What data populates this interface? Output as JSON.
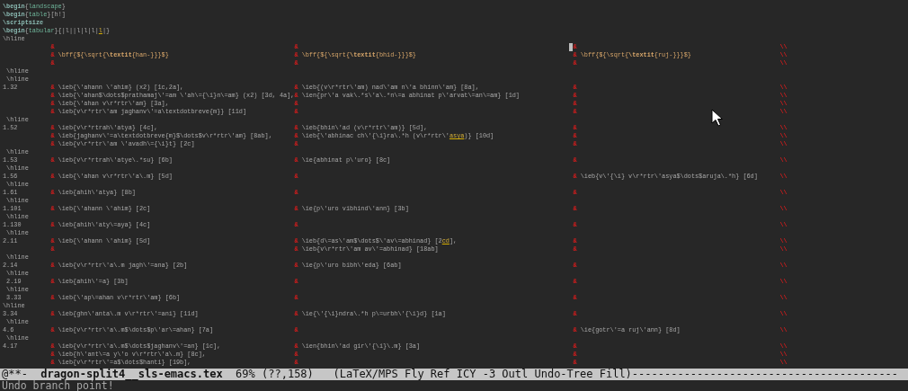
{
  "lines": [
    {
      "kind": "code",
      "segs": [
        {
          "t": "\\begin",
          "kind": "keyword"
        },
        {
          "t": "{",
          "kind": "plain"
        },
        {
          "t": "landscape",
          "kind": "arg"
        },
        {
          "t": "}",
          "kind": "plain"
        }
      ]
    },
    {
      "kind": "code",
      "segs": [
        {
          "t": "\\begin",
          "kind": "keyword"
        },
        {
          "t": "{",
          "kind": "plain"
        },
        {
          "t": "table",
          "kind": "arg"
        },
        {
          "t": "}[h!]",
          "kind": "plain"
        }
      ]
    },
    {
      "kind": "code",
      "segs": [
        {
          "t": "\\scriptsize",
          "kind": "keyword"
        }
      ]
    },
    {
      "kind": "code",
      "segs": [
        {
          "t": "\\begin",
          "kind": "keyword"
        },
        {
          "t": "{",
          "kind": "plain"
        },
        {
          "t": "tabular",
          "kind": "arg"
        },
        {
          "t": "}{|l||l|l|l|",
          "kind": "plain"
        },
        {
          "t": "l",
          "kind": "flagged"
        },
        {
          "t": "|}",
          "kind": "plain"
        }
      ]
    },
    {
      "kind": "code",
      "segs": [
        {
          "t": "\\hline",
          "kind": "plain"
        }
      ]
    },
    {
      "kind": "row",
      "cells": [
        {
          "sep": "&"
        },
        {
          "sep": "&"
        },
        {
          "sep": "&",
          "cursor": true
        }
      ],
      "end": "\\\\"
    },
    {
      "kind": "row",
      "cells": [
        {
          "sep": "&",
          "segs": [
            {
              "t": "\\bff{${\\sqrt{",
              "kind": "accent"
            },
            {
              "t": "\\textit",
              "kind": "strong"
            },
            {
              "t": "{han-}}}$}",
              "kind": "accent"
            }
          ]
        },
        {
          "sep": "&",
          "segs": [
            {
              "t": "\\bff{${\\sqrt{",
              "kind": "accent"
            },
            {
              "t": "\\textit",
              "kind": "strong"
            },
            {
              "t": "{bhid-}}}$}",
              "kind": "accent"
            }
          ]
        },
        {
          "sep": "&",
          "segs": [
            {
              "t": "\\bff{${\\sqrt{",
              "kind": "accent"
            },
            {
              "t": "\\textit",
              "kind": "strong"
            },
            {
              "t": "{ruj-}}}$}",
              "kind": "accent"
            }
          ]
        }
      ],
      "end": "\\\\"
    },
    {
      "kind": "row",
      "cells": [
        {
          "sep": "&"
        },
        {
          "sep": "&"
        },
        {
          "sep": "&"
        }
      ],
      "end": "\\\\"
    },
    {
      "kind": "code",
      "segs": [
        {
          "t": " \\hline",
          "kind": "plain"
        }
      ]
    },
    {
      "kind": "code",
      "segs": [
        {
          "t": " \\hline",
          "kind": "plain"
        }
      ]
    },
    {
      "kind": "row",
      "lead": "1.32",
      "cells": [
        {
          "sep": "&",
          "text": "\\ieb{\\'ahann \\'ahim} (x2) [1c,2a],"
        },
        {
          "sep": "&",
          "text": "\\ieb{(v\\r*rtr\\'am) nad\\'am n\\'a bhinn\\'am} [8a],"
        },
        {
          "sep": "&"
        }
      ],
      "end": "\\\\"
    },
    {
      "kind": "row",
      "cells": [
        {
          "sep": "&",
          "text": "\\ieb{\\'ahan$\\dots$prathamaj\\'=am \\'ah\\={\\i}n\\=am} (x2) [3d, 4a],"
        },
        {
          "sep": "&",
          "text": "\\ien{pr\\'a vak\\.*s\\'a\\.*n\\=a abhinat p\\'arvat\\=an\\=am} [1d]"
        },
        {
          "sep": "&"
        }
      ],
      "end": "\\\\"
    },
    {
      "kind": "row",
      "cells": [
        {
          "sep": "&",
          "text": "\\ieb{\\'ahan v\\r*rtr\\'am} [3a],"
        },
        {
          "sep": "&"
        },
        {
          "sep": "&"
        }
      ],
      "end": "\\\\"
    },
    {
      "kind": "row",
      "cells": [
        {
          "sep": "&",
          "text": "\\ieb{v\\r*rtr\\'am jaghanv\\'=a\\textdotbreve{m}} [11d]"
        },
        {
          "sep": "&"
        },
        {
          "sep": "&"
        }
      ],
      "end": "\\\\"
    },
    {
      "kind": "code",
      "segs": [
        {
          "t": " \\hline",
          "kind": "plain"
        }
      ]
    },
    {
      "kind": "row",
      "lead": "1.52",
      "cells": [
        {
          "sep": "&",
          "text": "\\ieb{v\\r*rtrah\\'atya} [4c],"
        },
        {
          "sep": "&",
          "text": "\\ieb{bhin\\'ad (v\\r*rtr\\'am)} [5d],"
        },
        {
          "sep": "&"
        }
      ],
      "end": "\\\\"
    },
    {
      "kind": "row",
      "cells": [
        {
          "sep": "&",
          "text": "\\ieb{jaghanv\\'=a\\textdotbreve{m}$\\dots$v\\r*rtr\\'am} [8ab],"
        },
        {
          "sep": "&",
          "segs": [
            {
              "t": "\\ieb{\\'abhinac ch\\'{\\i}ra\\.*h (v\\r*rtr\\'",
              "kind": "plain"
            },
            {
              "t": "asya",
              "kind": "flagged"
            },
            {
              "t": ")} [10d]",
              "kind": "plain"
            }
          ]
        },
        {
          "sep": "&"
        }
      ],
      "end": "\\\\"
    },
    {
      "kind": "row",
      "cells": [
        {
          "sep": "&",
          "text": "\\ieb{v\\r*rtr\\'am \\'avadh\\={\\i}t} [2c]"
        },
        {
          "sep": "&"
        },
        {
          "sep": "&"
        }
      ],
      "end": "\\\\"
    },
    {
      "kind": "code",
      "segs": [
        {
          "t": " \\hline",
          "kind": "plain"
        }
      ]
    },
    {
      "kind": "row",
      "lead": "1.53",
      "cells": [
        {
          "sep": "&",
          "text": "\\ieb{v\\r*rtrah\\'atye\\.*su} [6b]"
        },
        {
          "sep": "&",
          "text": "\\ie{abhinat p\\'uro} [8c]"
        },
        {
          "sep": "&"
        }
      ],
      "end": "\\\\"
    },
    {
      "kind": "code",
      "segs": [
        {
          "t": " \\hline",
          "kind": "plain"
        }
      ]
    },
    {
      "kind": "row",
      "lead": "1.56",
      "cells": [
        {
          "sep": "&",
          "text": "\\ieb{\\'ahan v\\r*rtr\\'a\\.m} [5d]"
        },
        {
          "sep": "&"
        },
        {
          "sep": "&",
          "text": "\\ieb{v\\'{\\i} v\\r*rtr\\'asya$\\dots$aruja\\.*h} [6d]"
        }
      ],
      "end": "\\\\"
    },
    {
      "kind": "code",
      "segs": [
        {
          "t": " \\hline",
          "kind": "plain"
        }
      ]
    },
    {
      "kind": "row",
      "lead": "1.61",
      "cells": [
        {
          "sep": "&",
          "text": "\\ieb{ahih\\'atya} [8b]"
        },
        {
          "sep": "&"
        },
        {
          "sep": "&"
        }
      ],
      "end": "\\\\"
    },
    {
      "kind": "code",
      "segs": [
        {
          "t": " \\hline",
          "kind": "plain"
        }
      ]
    },
    {
      "kind": "row",
      "lead": "1.101",
      "cells": [
        {
          "sep": "&",
          "text": "\\ieb{\\'ahann \\'ahim} [2c]"
        },
        {
          "sep": "&",
          "text": "\\ie{p\\'uro vibhind\\'ann} [3b]"
        },
        {
          "sep": "&"
        }
      ],
      "end": "\\\\"
    },
    {
      "kind": "code",
      "segs": [
        {
          "t": " \\hline",
          "kind": "plain"
        }
      ]
    },
    {
      "kind": "row",
      "lead": "1.130",
      "cells": [
        {
          "sep": "&",
          "text": "\\ieb{ahih\\'aty\\=aya} [4c]"
        },
        {
          "sep": "&"
        },
        {
          "sep": "&"
        }
      ],
      "end": "\\\\"
    },
    {
      "kind": "code",
      "segs": [
        {
          "t": " \\hline",
          "kind": "plain"
        }
      ]
    },
    {
      "kind": "row",
      "lead": "2.11",
      "cells": [
        {
          "sep": "&",
          "text": "\\ieb{\\'ahann \\'ahim} [5d]"
        },
        {
          "sep": "&",
          "segs": [
            {
              "t": "\\ieb{d\\=as\\'am$\\dots$\\'av\\=abhinad} [2",
              "kind": "plain"
            },
            {
              "t": "cd",
              "kind": "flagged"
            },
            {
              "t": "],",
              "kind": "plain"
            }
          ]
        },
        {
          "sep": "&"
        }
      ],
      "end": "\\\\"
    },
    {
      "kind": "row",
      "cells": [
        {
          "sep": "&"
        },
        {
          "sep": "&",
          "text": "\\ieb{v\\r*rtr\\'am av\\'=abhinad} [18ab]"
        },
        {
          "sep": "&"
        }
      ],
      "end": "\\\\"
    },
    {
      "kind": "code",
      "segs": [
        {
          "t": " \\hline",
          "kind": "plain"
        }
      ]
    },
    {
      "kind": "row",
      "lead": "2.14",
      "cells": [
        {
          "sep": "&",
          "text": "\\ieb{v\\r*rtr\\'a\\.m jagh\\'=ana} [2b]"
        },
        {
          "sep": "&",
          "text": "\\ie{p\\'uro bibh\\'eda} [6ab]"
        },
        {
          "sep": "&"
        }
      ],
      "end": "\\\\"
    },
    {
      "kind": "code",
      "segs": [
        {
          "t": " \\hline",
          "kind": "plain"
        }
      ]
    },
    {
      "kind": "row",
      "lead": " 2.19",
      "cells": [
        {
          "sep": "&",
          "text": "\\ieb{ahih\\'=a} [3b]"
        },
        {
          "sep": "&"
        },
        {
          "sep": "&"
        }
      ],
      "end": "\\\\"
    },
    {
      "kind": "code",
      "segs": [
        {
          "t": " \\hline",
          "kind": "plain"
        }
      ]
    },
    {
      "kind": "row",
      "lead": " 3.33",
      "cells": [
        {
          "sep": "&",
          "text": "\\ieb{\\'ap\\=ahan v\\r*rtr\\'am} [6b]"
        },
        {
          "sep": "&"
        },
        {
          "sep": "&"
        }
      ],
      "end": "\\\\"
    },
    {
      "kind": "code",
      "segs": [
        {
          "t": "\\hline",
          "kind": "plain"
        }
      ]
    },
    {
      "kind": "row",
      "lead": "3.34",
      "cells": [
        {
          "sep": "&",
          "text": "\\ieb{ghn\\'anta\\.m v\\r*rtr\\'=ani} [11d]"
        },
        {
          "sep": "&",
          "text": "\\ie{\\'{\\i}ndra\\.*h p\\=urbh\\'{\\i}d} [1a]"
        },
        {
          "sep": "&"
        }
      ],
      "end": "\\\\"
    },
    {
      "kind": "code",
      "segs": [
        {
          "t": " \\hline",
          "kind": "plain"
        }
      ]
    },
    {
      "kind": "row",
      "lead": "4.6",
      "cells": [
        {
          "sep": "&",
          "text": "\\ieb{v\\r*rtr\\'a\\.m$\\dots$p\\'ar\\=ahan} [7a]"
        },
        {
          "sep": "&"
        },
        {
          "sep": "&",
          "text": "\\ie{gotr\\'=a ruj\\'ann} [8d]"
        }
      ],
      "end": "\\\\"
    },
    {
      "kind": "code",
      "segs": [
        {
          "t": " \\hline",
          "kind": "plain"
        }
      ]
    },
    {
      "kind": "row",
      "lead": "4.17",
      "cells": [
        {
          "sep": "&",
          "text": "\\ieb{v\\r*rtr\\'a\\.m$\\dots$jaghanv\\'=an} [1c],"
        },
        {
          "sep": "&",
          "text": "\\ien{bhin\\'ad gir\\'{\\i}\\.m} [3a]"
        },
        {
          "sep": "&"
        }
      ],
      "end": "\\\\"
    },
    {
      "kind": "row",
      "cells": [
        {
          "sep": "&",
          "text": "\\ieb{h\\'ant\\=a y\\'o v\\r*rtr\\'a\\.m} [8c],"
        },
        {
          "sep": "&"
        },
        {
          "sep": "&"
        }
      ],
      "end": "\\\\"
    },
    {
      "kind": "row",
      "cells": [
        {
          "sep": "&",
          "text": "\\ieb{v\\r*rtr\\'=a$\\dots$hanti} [19b],"
        },
        {
          "sep": "&"
        },
        {
          "sep": "&"
        }
      ],
      "end": "\\\\"
    }
  ],
  "mode_line": {
    "status": "@**-",
    "buffer": "dragon-split4__sls-emacs.tex",
    "position": "69% (??,158)",
    "modes": "(LaTeX/MPS Fly Ref ICY -3 Outl Undo-Tree Fill)",
    "fill": "-----------------------------------------"
  },
  "echo_area": "Undo branch point!"
}
